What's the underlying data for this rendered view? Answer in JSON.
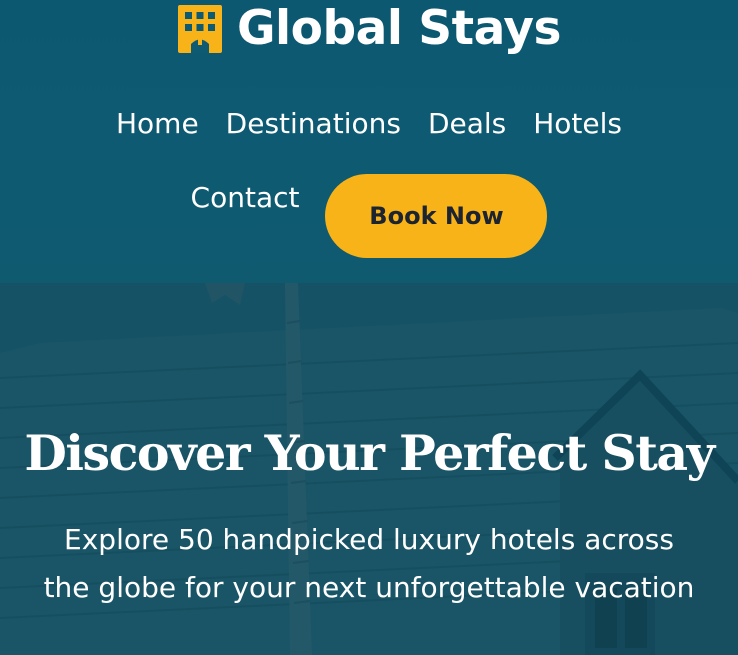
{
  "brand": {
    "name": "Global Stays",
    "icon": "hotel-building-icon",
    "icon_color": "#f8b318"
  },
  "nav": {
    "items": [
      "Home",
      "Destinations",
      "Deals",
      "Hotels",
      "Contact"
    ],
    "cta_label": "Book Now"
  },
  "hero": {
    "title": "Discover Your Perfect Stay",
    "subtitle": "Explore 50 handpicked luxury hotels across the globe for your next unforgettable vacation"
  },
  "colors": {
    "header_bg": "#0e5a72",
    "hero_overlay": "#16566a",
    "accent": "#f8b318",
    "text": "#ffffff"
  }
}
